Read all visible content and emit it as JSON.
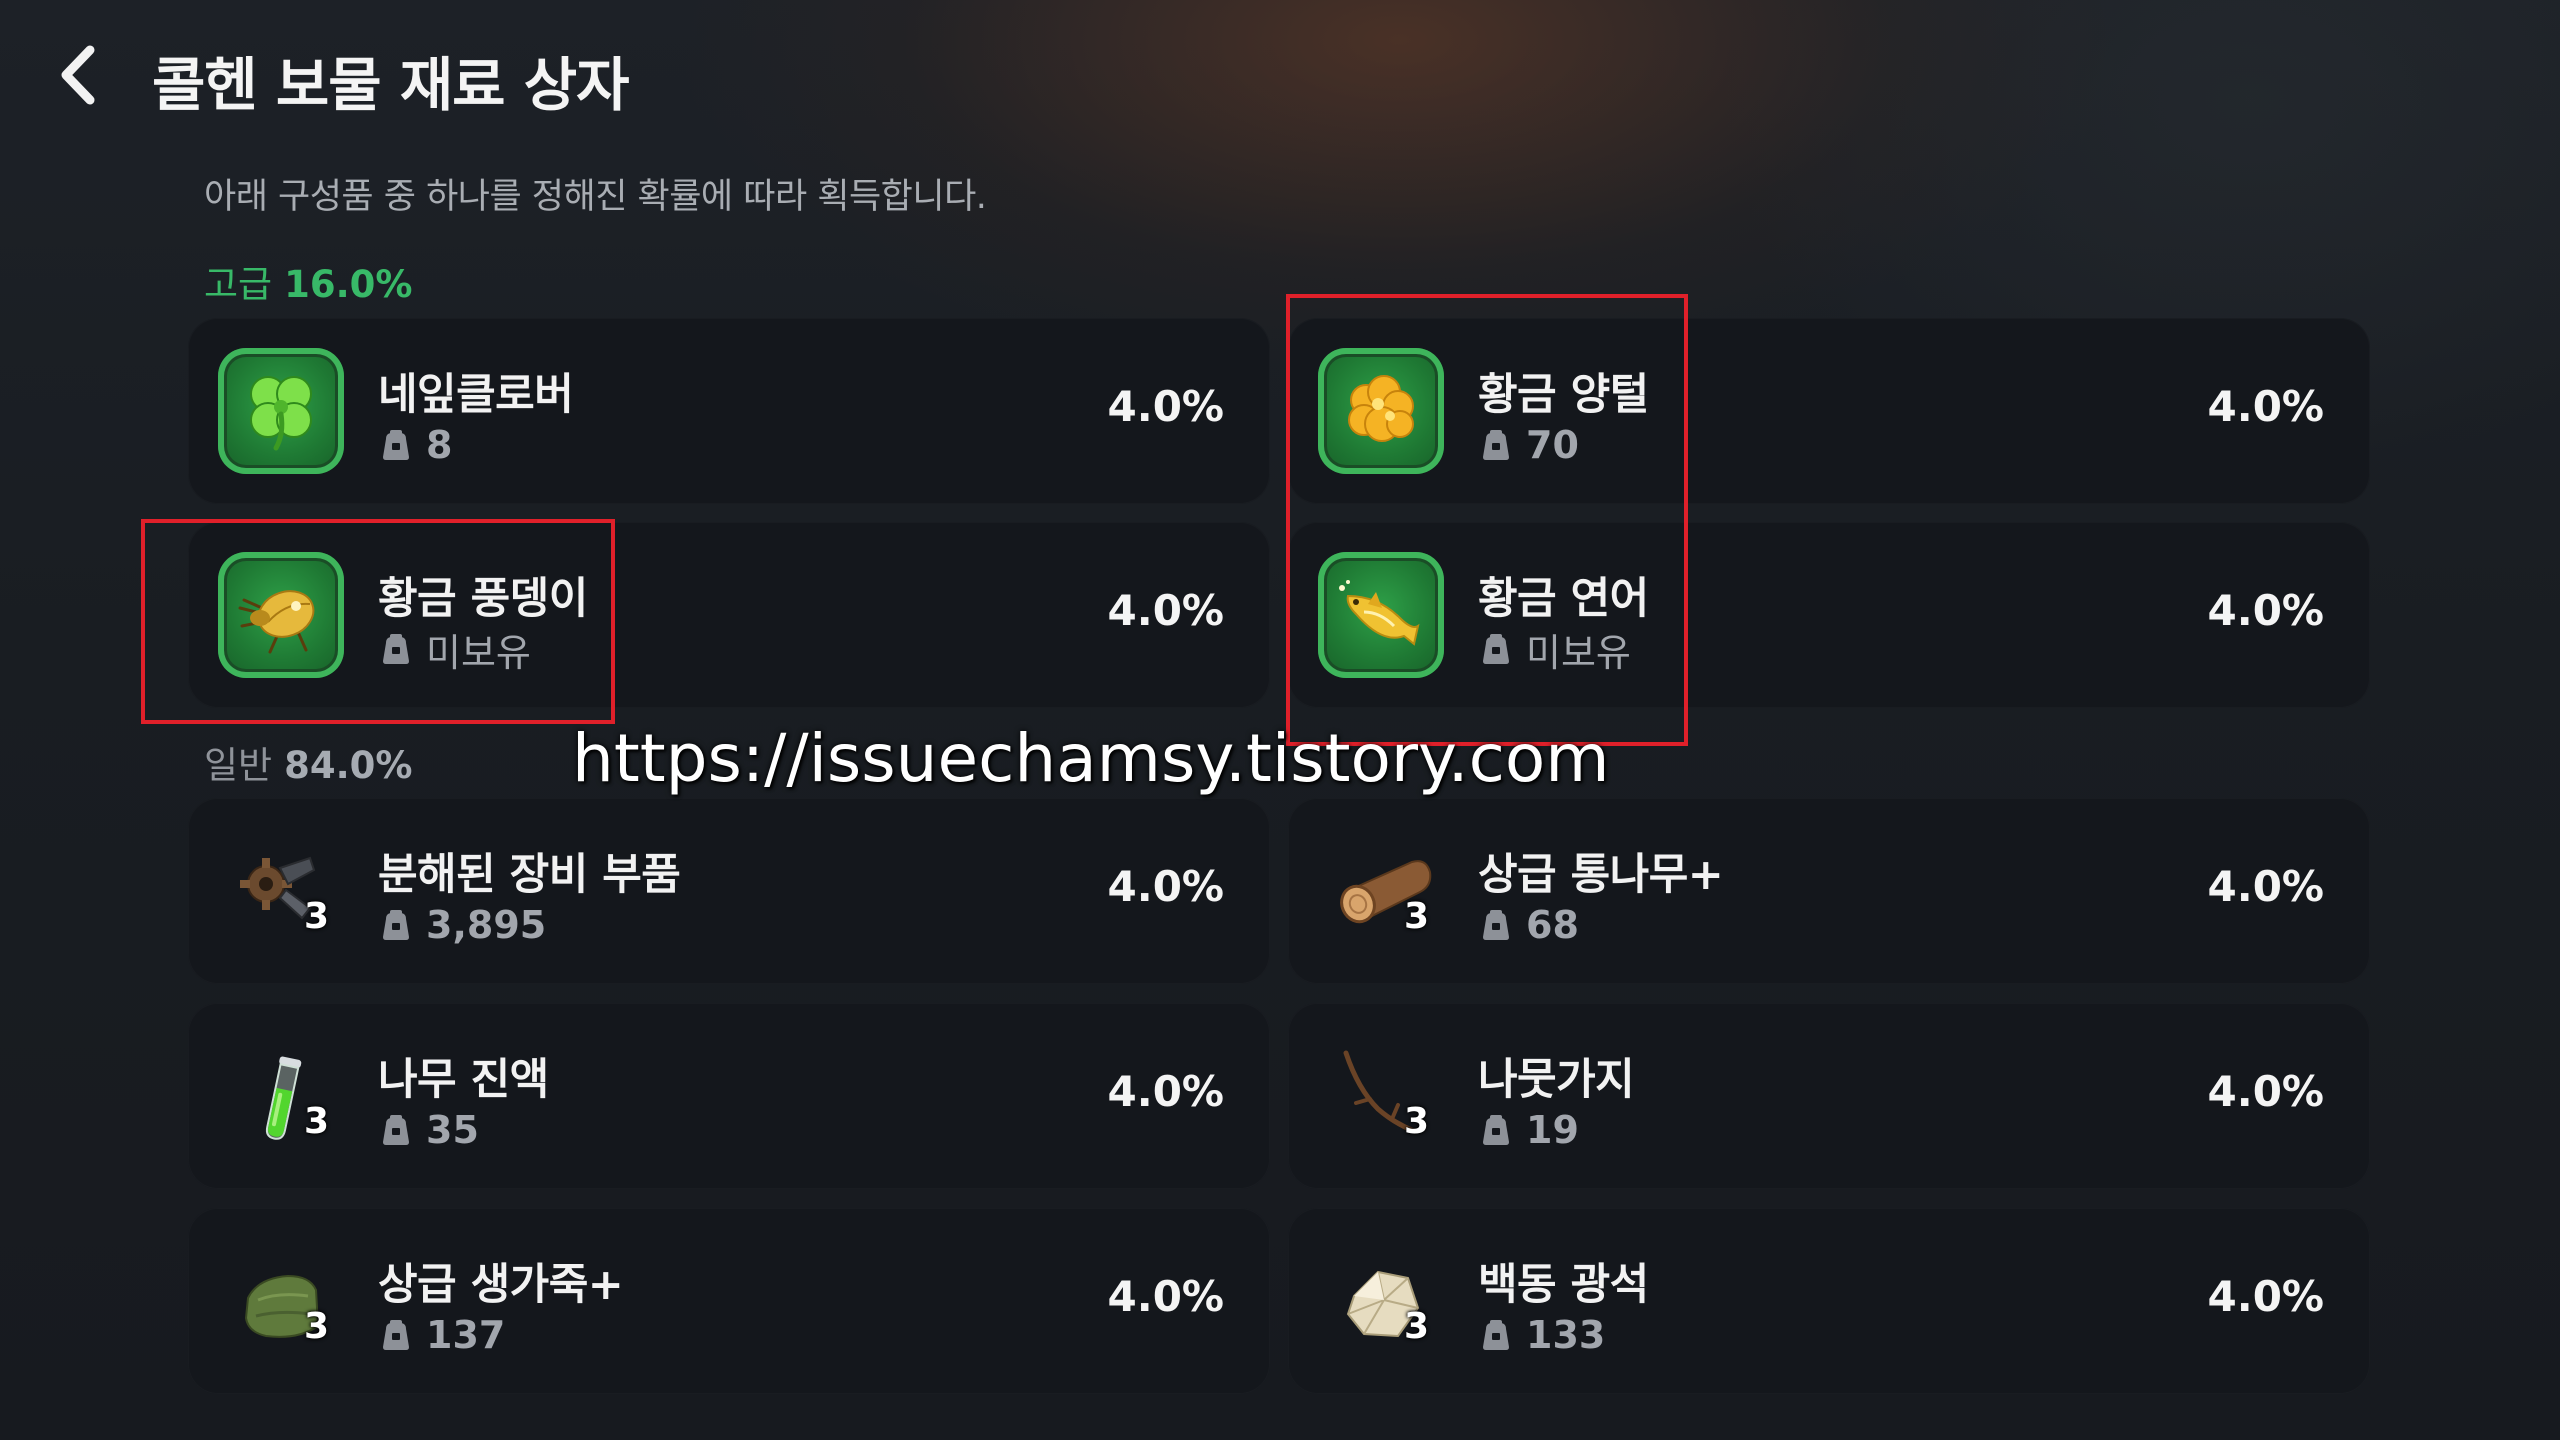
{
  "header": {
    "back_icon": "chevron-left-icon",
    "title": "콜헨 보물 재료 상자"
  },
  "description": "아래 구성품 중 하나를 정해진 확률에 따라 획득합니다.",
  "grades": {
    "high": {
      "label": "고급",
      "percent": "16.0%",
      "color": "#38b968"
    },
    "normal": {
      "label": "일반",
      "percent": "84.0%",
      "color": "#8f939a"
    }
  },
  "owned_icon": "bag-icon",
  "high_items": [
    {
      "name": "네잎클로버",
      "owned": "8",
      "chance": "4.0%",
      "icon": "clover-icon"
    },
    {
      "name": "황금 양털",
      "owned": "70",
      "chance": "4.0%",
      "icon": "golden-wool-icon"
    },
    {
      "name": "황금 풍뎅이",
      "owned": "미보유",
      "chance": "4.0%",
      "icon": "golden-beetle-icon"
    },
    {
      "name": "황금 연어",
      "owned": "미보유",
      "chance": "4.0%",
      "icon": "golden-salmon-icon"
    }
  ],
  "normal_items": [
    {
      "name": "분해된 장비 부품",
      "qty": "3",
      "owned": "3,895",
      "chance": "4.0%",
      "icon": "gear-parts-icon"
    },
    {
      "name": "상급 통나무+",
      "qty": "3",
      "owned": "68",
      "chance": "4.0%",
      "icon": "log-icon"
    },
    {
      "name": "나무 진액",
      "qty": "3",
      "owned": "35",
      "chance": "4.0%",
      "icon": "sap-vial-icon"
    },
    {
      "name": "나뭇가지",
      "qty": "3",
      "owned": "19",
      "chance": "4.0%",
      "icon": "twig-icon"
    },
    {
      "name": "상급 생가죽+",
      "qty": "3",
      "owned": "137",
      "chance": "4.0%",
      "icon": "hide-icon"
    },
    {
      "name": "백동 광석",
      "qty": "3",
      "owned": "133",
      "chance": "4.0%",
      "icon": "ore-icon"
    }
  ],
  "watermark": "https://issuechamsy.tistory.com",
  "highlight_color": "#e0202a"
}
